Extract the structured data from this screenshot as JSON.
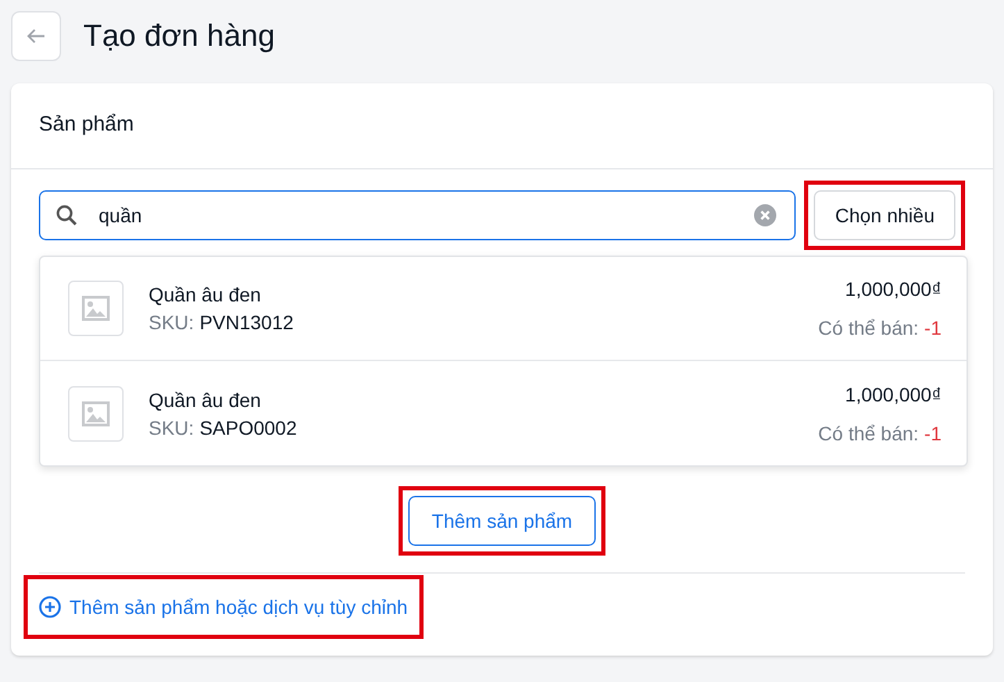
{
  "page": {
    "title": "Tạo đơn hàng"
  },
  "products_card": {
    "title": "Sản phẩm",
    "search": {
      "value": "quần"
    },
    "multi_select_button": {
      "label": "Chọn nhiều",
      "highlighted": true
    },
    "results": [
      {
        "name": "Quần âu đen",
        "sku_label": "SKU:",
        "sku": "PVN13012",
        "price": "1,000,000₫",
        "stock_label": "Có thể bán:",
        "stock": "-1"
      },
      {
        "name": "Quần âu đen",
        "sku_label": "SKU:",
        "sku": "SAPO0002",
        "price": "1,000,000₫",
        "stock_label": "Có thể bán:",
        "stock": "-1"
      }
    ],
    "add_button": {
      "label": "Thêm sản phẩm",
      "highlighted": true
    },
    "custom_link": {
      "label": "Thêm sản phẩm hoặc dịch vụ tùy chỉnh",
      "highlighted": true
    }
  }
}
